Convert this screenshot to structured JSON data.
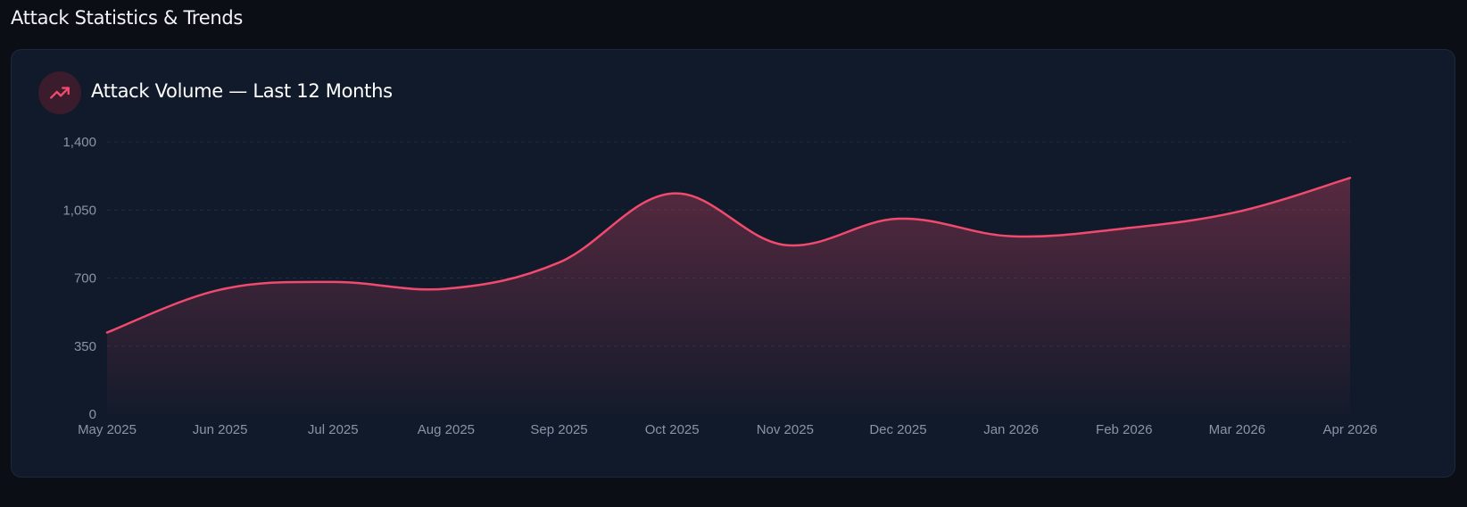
{
  "section": {
    "title": "Attack Statistics & Trends"
  },
  "card": {
    "title": "Attack Volume — Last 12 Months",
    "icon": "trending-up-icon"
  },
  "colors": {
    "background": "#0b0e14",
    "card": "#101a2a",
    "line": "#f04a6e",
    "icon_bg": "#3a1c2d",
    "tick": "#8a94a6",
    "grid": "#1f2c3a"
  },
  "chart_data": {
    "type": "area",
    "title": "Attack Volume — Last 12 Months",
    "xlabel": "",
    "ylabel": "",
    "categories": [
      "May 2025",
      "Jun 2025",
      "Jul 2025",
      "Aug 2025",
      "Sep 2025",
      "Oct 2025",
      "Nov 2025",
      "Dec 2025",
      "Jan 2026",
      "Feb 2026",
      "Mar 2026",
      "Apr 2026"
    ],
    "series": [
      {
        "values": [
          420,
          640,
          680,
          645,
          780,
          1135,
          870,
          1005,
          915,
          955,
          1040,
          1215
        ]
      }
    ],
    "ylim": [
      0,
      1400
    ],
    "yticks": [
      0,
      350,
      700,
      1050,
      1400
    ],
    "ytick_labels": [
      "0",
      "350",
      "700",
      "1,050",
      "1,400"
    ],
    "grid": true,
    "legend": "none",
    "curve": "smooth"
  }
}
